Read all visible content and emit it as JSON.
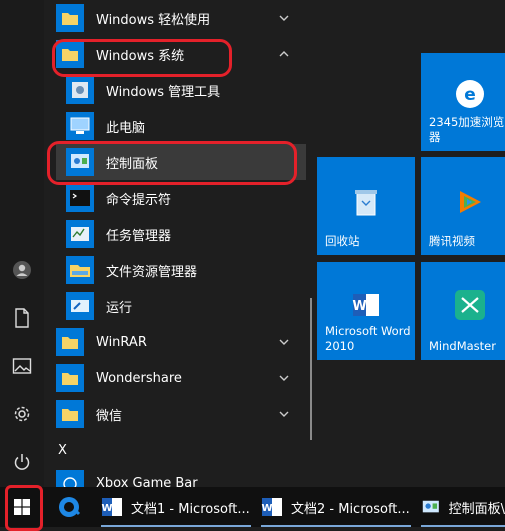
{
  "app_list": {
    "items": [
      {
        "label": "Windows 轻松使用",
        "chevron": "down"
      },
      {
        "label": "Windows 系统",
        "chevron": "up"
      },
      {
        "label": "Windows 管理工具"
      },
      {
        "label": "此电脑"
      },
      {
        "label": "控制面板"
      },
      {
        "label": "命令提示符"
      },
      {
        "label": "任务管理器"
      },
      {
        "label": "文件资源管理器"
      },
      {
        "label": "运行"
      },
      {
        "label": "WinRAR",
        "chevron": "down"
      },
      {
        "label": "Wondershare",
        "chevron": "down"
      },
      {
        "label": "微信",
        "chevron": "down"
      },
      {
        "label": "Xbox Game Bar"
      }
    ],
    "section_letter": "X"
  },
  "tiles": [
    {
      "label": "2345加速浏览器"
    },
    {
      "label": "回收站"
    },
    {
      "label": "腾讯视频"
    },
    {
      "label": "Microsoft Word 2010"
    },
    {
      "label": "MindMaster"
    }
  ],
  "taskbar": {
    "items": [
      {
        "label": "文档1 - Microsoft..."
      },
      {
        "label": "文档2 - Microsoft..."
      },
      {
        "label": "控制面板\\"
      }
    ]
  },
  "colors": {
    "accent": "#0078d7",
    "annotation": "#e4212a"
  }
}
